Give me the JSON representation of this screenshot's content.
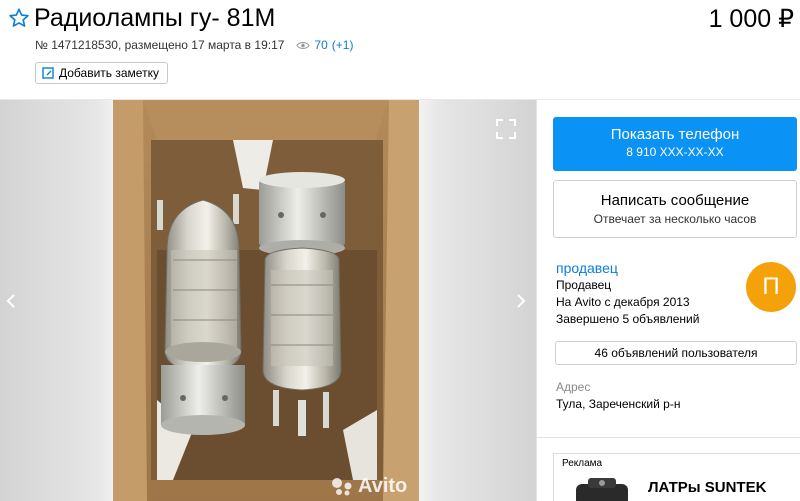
{
  "header": {
    "title": "Радиолампы гу- 81М",
    "price": "1 000 ₽",
    "meta_text": "№ 1471218530, размещено 17 марта в 19:17",
    "views": "70",
    "views_delta": "(+1)",
    "note_button_label": "Добавить заметку"
  },
  "gallery": {
    "watermark": "Avito"
  },
  "contact": {
    "phone_button_label": "Показать телефон",
    "phone_number": "8 910 XXX-XX-XX",
    "message_button_label": "Написать сообщение",
    "message_button_sub": "Отвечает за несколько часов"
  },
  "seller": {
    "name": "продавец",
    "type": "Продавец",
    "since": "На Avito с декабря 2013",
    "completed": "Завершено 5 объявлений",
    "avatar_letter": "П",
    "ads_button_label": "46 объявлений пользователя"
  },
  "address": {
    "label": "Адрес",
    "value": "Тула, Зареченский р-н"
  },
  "ad": {
    "label": "Реклама",
    "title": "ЛАТРы SUNTEK"
  },
  "colors": {
    "accent_blue": "#0a92f5",
    "link_blue": "#0a7ed8",
    "avatar_orange": "#f5a20a"
  }
}
